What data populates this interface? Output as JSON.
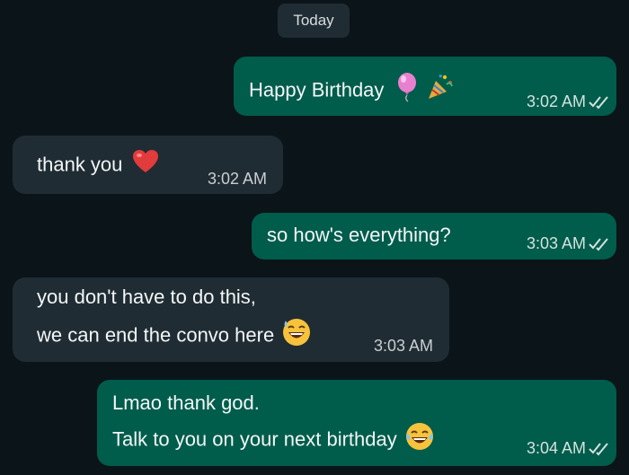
{
  "date_chip": "Today",
  "messages": [
    {
      "direction": "outgoing",
      "text": "Happy Birthday",
      "emoji": [
        "balloon-icon",
        "party-popper-icon"
      ],
      "time": "3:02 AM",
      "status": "read"
    },
    {
      "direction": "incoming",
      "text": "thank you",
      "emoji": [
        "red-heart-icon"
      ],
      "time": "3:02 AM"
    },
    {
      "direction": "outgoing",
      "text": "so how's everything?",
      "time": "3:03 AM",
      "status": "read"
    },
    {
      "direction": "incoming",
      "line1": "you don't have to do this,",
      "line2": "we can end the convo here",
      "emoji": [
        "grinning-sweat-icon"
      ],
      "time": "3:03 AM"
    },
    {
      "direction": "outgoing",
      "line1": "Lmao thank god.",
      "line2": "Talk to you on your next birthday",
      "emoji": [
        "tears-of-joy-icon"
      ],
      "time": "3:04 AM",
      "status": "read"
    }
  ],
  "colors": {
    "background": "#0b1418",
    "outgoing_bubble": "#005c4b",
    "incoming_bubble": "#202c33",
    "read_ticks": "#d4e2df"
  }
}
